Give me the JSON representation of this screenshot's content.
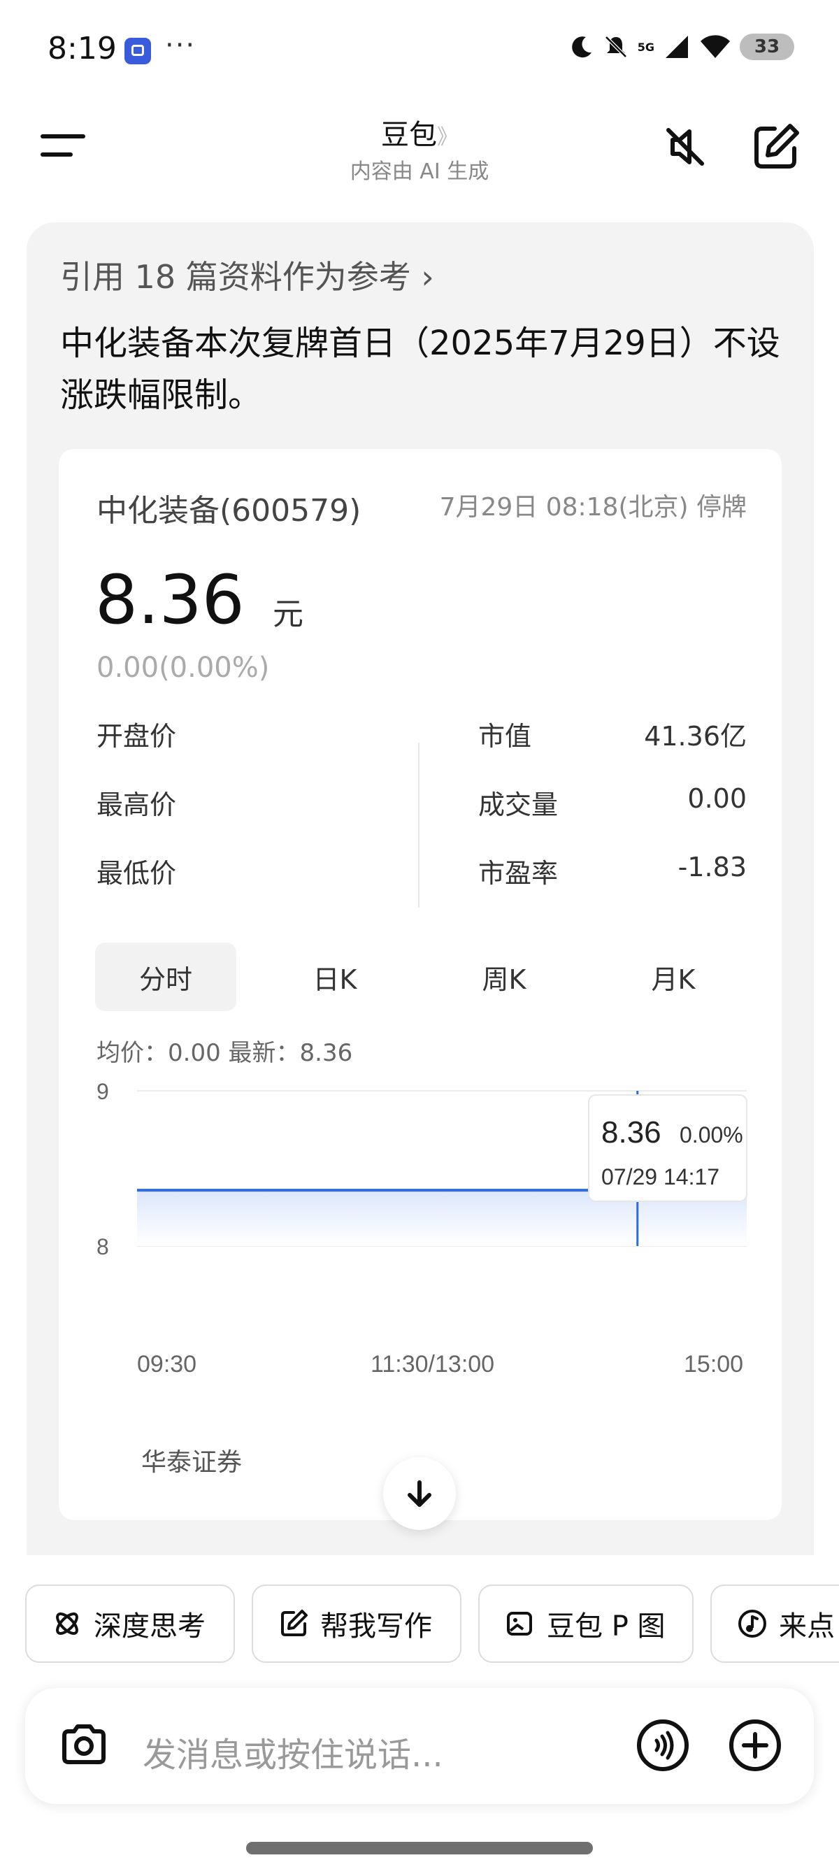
{
  "status_bar": {
    "time": "8:19",
    "more": "···",
    "network": "5G",
    "battery": "33",
    "icons": [
      "moon-icon",
      "mute-bell-icon",
      "signal-icon",
      "wifi-icon",
      "battery-icon"
    ]
  },
  "header": {
    "title": "豆包",
    "title_chevron": "》",
    "subtitle": "内容由 AI 生成"
  },
  "answer": {
    "reference": "引用 18 篇资料作为参考 ›",
    "text": "中化装备本次复牌首日（2025年7月29日）不设涨跌幅限制。"
  },
  "stock": {
    "name": "中化装备(600579)",
    "datetime_status": "7月29日 08:18(北京) 停牌",
    "price": "8.36",
    "price_unit": "元",
    "change": "0.00(0.00%)",
    "metrics_left": [
      {
        "label": "开盘价",
        "value": ""
      },
      {
        "label": "最高价",
        "value": ""
      },
      {
        "label": "最低价",
        "value": ""
      }
    ],
    "metrics_right": [
      {
        "label": "市值",
        "value": "41.36亿"
      },
      {
        "label": "成交量",
        "value": "0.00"
      },
      {
        "label": "市盈率",
        "value": "-1.83"
      }
    ],
    "tabs": [
      "分时",
      "日K",
      "周K",
      "月K"
    ],
    "active_tab": "分时",
    "avg_line": "均价：0.00   最新：8.36",
    "broker": "华泰证券",
    "tooltip": {
      "price": "8.36",
      "pct": "0.00%",
      "time": "07/29 14:17"
    }
  },
  "chart_data": {
    "type": "area",
    "title": "",
    "xlabel": "",
    "ylabel": "",
    "y_ticks": [
      "9",
      "8"
    ],
    "ylim": [
      8,
      9
    ],
    "x_ticks": [
      "09:30",
      "11:30/13:00",
      "15:00"
    ],
    "series": [
      {
        "x": [
          "09:30",
          "14:17",
          "15:00"
        ],
        "values": [
          8.36,
          8.36,
          8.36
        ]
      }
    ],
    "crosshair": {
      "x": "14:17",
      "y": 8.36
    },
    "colors": {
      "line": "#2f6bdb",
      "fill_top": "#dbe6fb",
      "grid": "#ececec"
    }
  },
  "chips": [
    {
      "label": "深度思考",
      "icon": "atom-icon"
    },
    {
      "label": "帮我写作",
      "icon": "pen-square-icon"
    },
    {
      "label": "豆包 P 图",
      "icon": "image-edit-icon"
    },
    {
      "label": "来点",
      "icon": "music-icon"
    }
  ],
  "input": {
    "placeholder": "发消息或按住说话..."
  }
}
